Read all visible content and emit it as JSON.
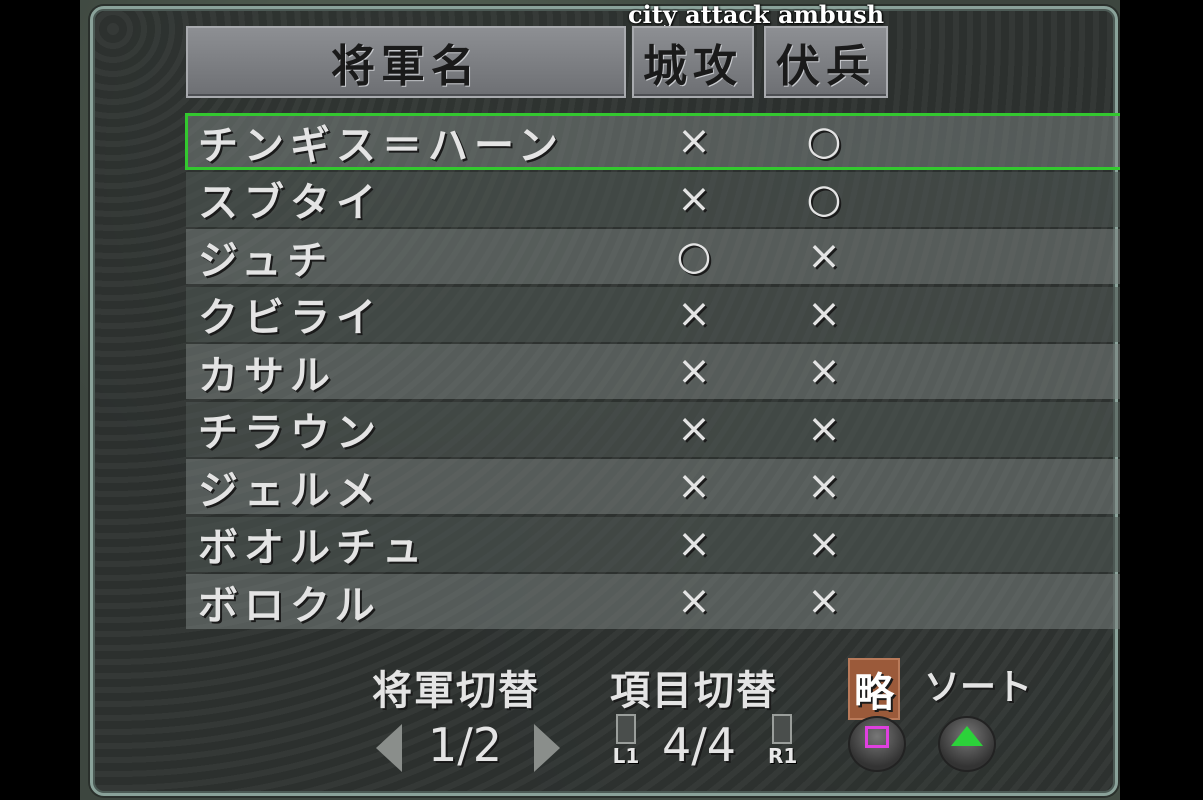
{
  "overlay_label": "city attack ambush",
  "header": {
    "name": "将軍名",
    "siege": "城攻",
    "ambush": "伏兵"
  },
  "generals": [
    {
      "name": "チンギス＝ハーン",
      "siege": "×",
      "ambush": "○"
    },
    {
      "name": "スブタイ",
      "siege": "×",
      "ambush": "○"
    },
    {
      "name": "ジュチ",
      "siege": "○",
      "ambush": "×"
    },
    {
      "name": "クビライ",
      "siege": "×",
      "ambush": "×"
    },
    {
      "name": "カサル",
      "siege": "×",
      "ambush": "×"
    },
    {
      "name": "チラウン",
      "siege": "×",
      "ambush": "×"
    },
    {
      "name": "ジェルメ",
      "siege": "×",
      "ambush": "×"
    },
    {
      "name": "ボオルチュ",
      "siege": "×",
      "ambush": "×"
    },
    {
      "name": "ボロクル",
      "siege": "×",
      "ambush": "×"
    }
  ],
  "footer": {
    "switch_general": "将軍切替",
    "switch_item": "項目切替",
    "abbrev": "略",
    "sort": "ソート",
    "page": "1/2",
    "item_page": "4/4",
    "l1": "L1",
    "r1": "R1"
  },
  "colors": {
    "selection": "#33c82f",
    "square": "#e040e0",
    "triangle": "#2cd23a"
  }
}
